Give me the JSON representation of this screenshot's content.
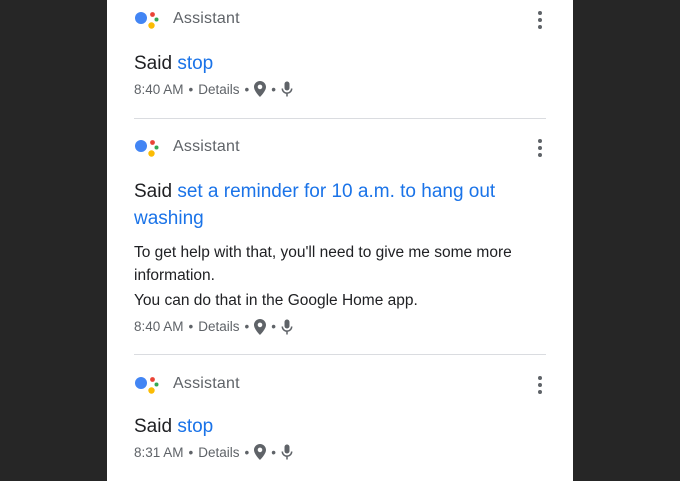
{
  "colors": {
    "background": "#262626",
    "panel": "#ffffff",
    "link_blue": "#1a73e8",
    "text": "#202124",
    "muted": "#5f6368",
    "logo_blue": "#4285f4",
    "logo_red": "#ea4335",
    "logo_yellow": "#fbbc04",
    "logo_green": "#34a853"
  },
  "entries": [
    {
      "app": "Assistant",
      "said_prefix": "Said",
      "query": "stop",
      "response": [],
      "time": "8:40 AM",
      "details": "Details",
      "bullet": "•",
      "icons": [
        "location-pin-icon",
        "microphone-icon"
      ]
    },
    {
      "app": "Assistant",
      "said_prefix": "Said",
      "query": "set a reminder for 10 a.m. to hang out washing",
      "response": [
        "To get help with that, you'll need to give me some more information.",
        "You can do that in the Google Home app."
      ],
      "time": "8:40 AM",
      "details": "Details",
      "bullet": "•",
      "icons": [
        "location-pin-icon",
        "microphone-icon"
      ]
    },
    {
      "app": "Assistant",
      "said_prefix": "Said",
      "query": "stop",
      "response": [],
      "time": "8:31 AM",
      "details": "Details",
      "bullet": "•",
      "icons": [
        "location-pin-icon",
        "microphone-icon"
      ]
    }
  ]
}
